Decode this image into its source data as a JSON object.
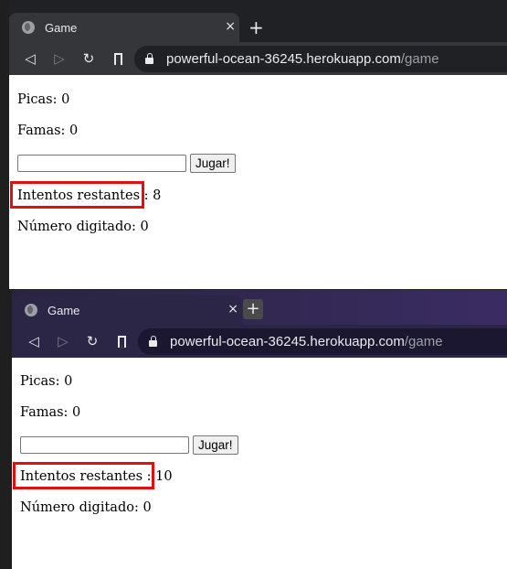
{
  "windows": [
    {
      "tab": {
        "title": "Game",
        "close": "×"
      },
      "newtab": "+",
      "nav": {
        "back": "◁",
        "forward": "▷",
        "reload": "↻"
      },
      "url": {
        "host": "powerful-ocean-36245.herokuapp.com",
        "path": "/game"
      },
      "game": {
        "picas": "Picas: 0",
        "famas": "Famas: 0",
        "input_value": "",
        "play_button": "Jugar!",
        "intentos": "Intentos restantes : 8",
        "numero": "Número digitado: 0"
      }
    },
    {
      "tab": {
        "title": "Game",
        "close": "×"
      },
      "newtab": "+",
      "nav": {
        "back": "◁",
        "forward": "▷",
        "reload": "↻"
      },
      "url": {
        "host": "powerful-ocean-36245.herokuapp.com",
        "path": "/game"
      },
      "game": {
        "picas": "Picas: 0",
        "famas": "Famas: 0",
        "input_value": "",
        "play_button": "Jugar!",
        "intentos": "Intentos restantes : 10",
        "numero": "Número digitado: 0"
      }
    }
  ],
  "colors": {
    "highlight": "#e01010",
    "tab_dark": "#35363a",
    "tab_purple": "#2b2546"
  }
}
